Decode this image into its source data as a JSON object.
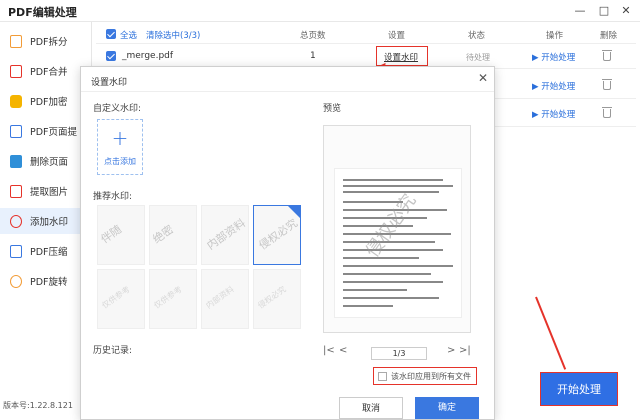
{
  "app": {
    "title": "PDF编辑处理",
    "version": "版本号:1.22.8.121"
  },
  "window": {
    "minimize": "—",
    "maximize": "□",
    "close": "✕"
  },
  "sidebar": {
    "items": [
      {
        "label": "PDF拆分",
        "icon": "split-icon",
        "color": "#f29c38"
      },
      {
        "label": "PDF合并",
        "icon": "merge-icon",
        "color": "#e5332a"
      },
      {
        "label": "PDF加密",
        "icon": "lock-icon",
        "color": "#f5b400"
      },
      {
        "label": "PDF页面提",
        "icon": "extract-page-icon",
        "color": "#3a78e0"
      },
      {
        "label": "删除页面",
        "icon": "delete-page-icon",
        "color": "#2f8fd8"
      },
      {
        "label": "提取图片",
        "icon": "image-icon",
        "color": "#e5332a"
      },
      {
        "label": "添加水印",
        "icon": "watermark-icon",
        "color": "#e5332a"
      },
      {
        "label": "PDF压缩",
        "icon": "compress-icon",
        "color": "#3a78e0"
      },
      {
        "label": "PDF旋转",
        "icon": "rotate-icon",
        "color": "#f29c38"
      }
    ],
    "active_index": 6
  },
  "list": {
    "headers": {
      "select_all": "全选",
      "clear_selected": "清除选中(3/3)",
      "pages": "总页数",
      "settings": "设置",
      "status": "状态",
      "action": "操作",
      "delete": "删除"
    },
    "rows": [
      {
        "name": "_merge.pdf",
        "pages": "1",
        "settings": "设置水印",
        "status": "待处理",
        "action": "开始处理"
      },
      {
        "action": "开始处理"
      },
      {
        "action": "开始处理"
      }
    ]
  },
  "dialog": {
    "title": "设置水印",
    "close": "✕",
    "custom_label": "自定义水印:",
    "add_label": "点击添加",
    "plus": "+",
    "recommended_label": "推荐水印:",
    "watermarks": [
      "伴随",
      "绝密",
      "内部资料",
      "侵权必究"
    ],
    "faded_watermarks": [
      "仅供参考",
      "仅供参考",
      "内部资料",
      "侵权必究"
    ],
    "selected_index": 3,
    "history_label": "历史记录:",
    "preview_label": "预览",
    "preview_watermark": "侵权必究",
    "pager": {
      "first": "|<",
      "prev": "<",
      "page": "1/3",
      "next": ">",
      "last": ">|"
    },
    "apply_all": "该水印应用到所有文件",
    "cancel": "取消",
    "ok": "确定"
  },
  "start_button": "开始处理"
}
